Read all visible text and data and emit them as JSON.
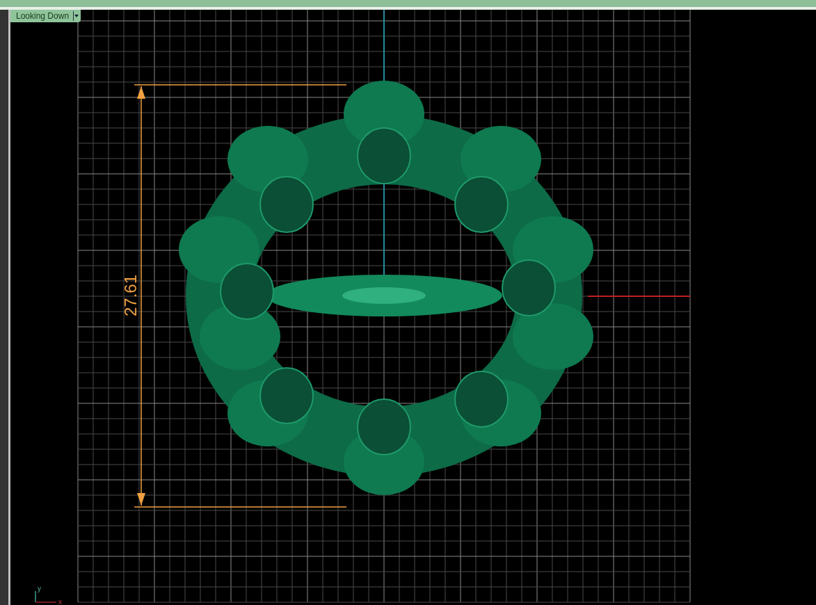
{
  "viewport": {
    "title": "Looking Down",
    "dimension": {
      "value": "27.61"
    },
    "axis_icon": {
      "y_label": "y",
      "x_label": "x"
    }
  }
}
